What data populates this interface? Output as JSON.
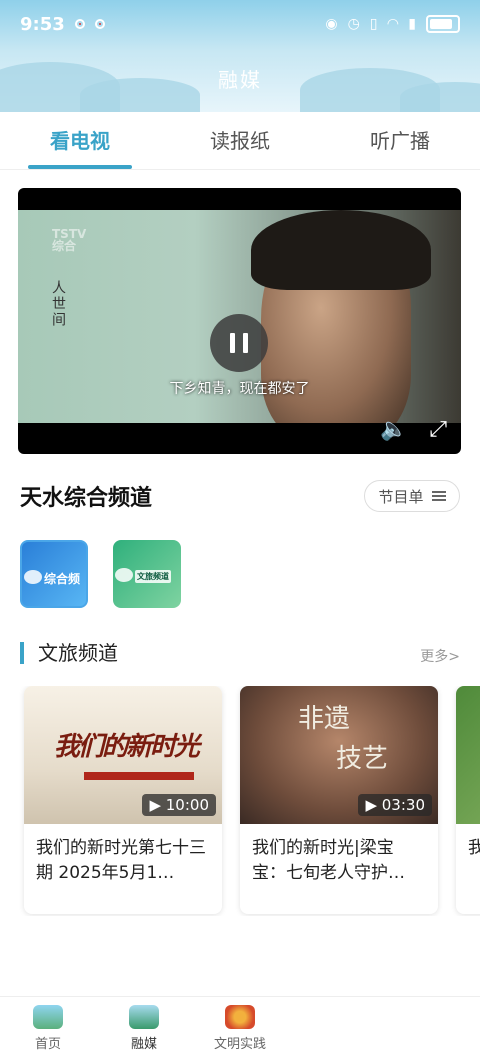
{
  "status_bar": {
    "time": "9:53"
  },
  "header": {
    "title": "融媒"
  },
  "tabs": [
    {
      "label": "看电视",
      "active": true
    },
    {
      "label": "读报纸",
      "active": false
    },
    {
      "label": "听广播",
      "active": false
    }
  ],
  "player": {
    "logo": "TSTV",
    "logo_sub": "综合",
    "show_title": "人世间",
    "subtitle": "下乡知青，现在都安了"
  },
  "channel": {
    "name": "天水综合频道",
    "schedule_label": "节目单",
    "thumbnails": [
      {
        "label": "综合频",
        "selected": true
      },
      {
        "label": "文旅频道",
        "selected": false
      }
    ]
  },
  "section": {
    "title": "文旅频道",
    "more_label": "更多>"
  },
  "videos": [
    {
      "title": "我们的新时光第七十三期 2025年5月1…",
      "duration": "10:00",
      "thumb_text": "我们的新时光"
    },
    {
      "title": "我们的新时光|梁宝宝：七旬老人守护…",
      "duration": "03:30",
      "thumb_text": "非遗",
      "thumb_text2": "技艺"
    },
    {
      "title": "我龙",
      "duration": ""
    }
  ],
  "bottom_nav": [
    {
      "label": "首页",
      "active": false
    },
    {
      "label": "融媒",
      "active": true
    },
    {
      "label": "文明实践",
      "active": false
    }
  ],
  "colors": {
    "accent": "#3aa3c8"
  }
}
